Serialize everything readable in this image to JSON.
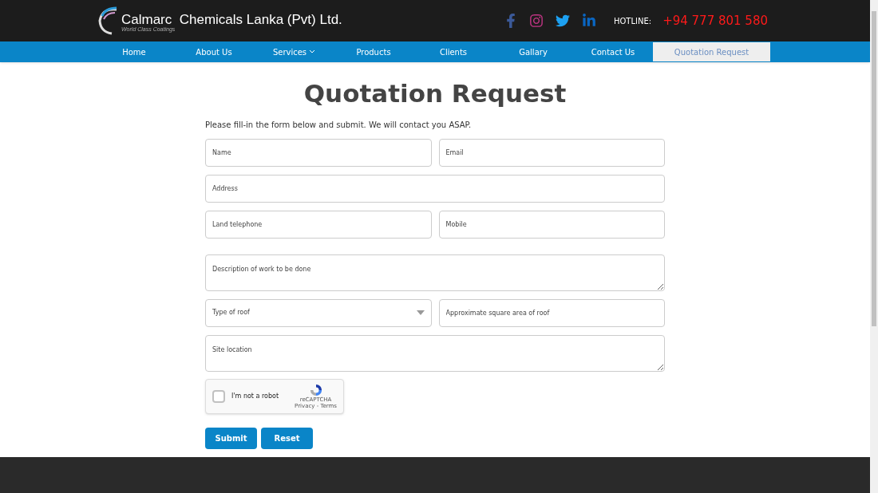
{
  "header": {
    "company": "Calmarc  Chemicals Lanka (Pvt) Ltd.",
    "tagline": "World Class Coatings",
    "hotline_label": "HOTLINE:",
    "hotline": "+94 777 801 580"
  },
  "nav": [
    {
      "label": "Home",
      "selected": false,
      "dropdown": false
    },
    {
      "label": "About Us",
      "selected": false,
      "dropdown": false
    },
    {
      "label": "Services",
      "selected": false,
      "dropdown": true
    },
    {
      "label": "Products",
      "selected": false,
      "dropdown": false
    },
    {
      "label": "Clients",
      "selected": false,
      "dropdown": false
    },
    {
      "label": "Gallary",
      "selected": false,
      "dropdown": false
    },
    {
      "label": "Contact Us",
      "selected": false,
      "dropdown": false
    },
    {
      "label": "Quotation Request",
      "selected": true,
      "dropdown": false
    }
  ],
  "page": {
    "title": "Quotation Request",
    "intro": "Please fill-in the form below and submit. We will contact you ASAP."
  },
  "form_rows": [
    [
      {
        "kind": "text",
        "placeholder": "Name"
      },
      {
        "kind": "text",
        "placeholder": "Email"
      }
    ],
    [
      {
        "kind": "text",
        "placeholder": "Address"
      }
    ],
    [
      {
        "kind": "text",
        "placeholder": "Land telephone"
      },
      {
        "kind": "text",
        "placeholder": "Mobile"
      }
    ],
    [
      {
        "kind": "textarea",
        "placeholder": "Description of work to be done"
      }
    ],
    [
      {
        "kind": "select",
        "placeholder": "Type of roof"
      },
      {
        "kind": "text",
        "placeholder": "Approximate square area of roof"
      }
    ],
    [
      {
        "kind": "textarea",
        "placeholder": "Site location"
      }
    ]
  ],
  "captcha": {
    "checked": false,
    "label": "I'm not a robot",
    "brand": "reCAPTCHA",
    "links": "Privacy - Terms"
  },
  "buttons": [
    "Submit",
    "Reset"
  ]
}
